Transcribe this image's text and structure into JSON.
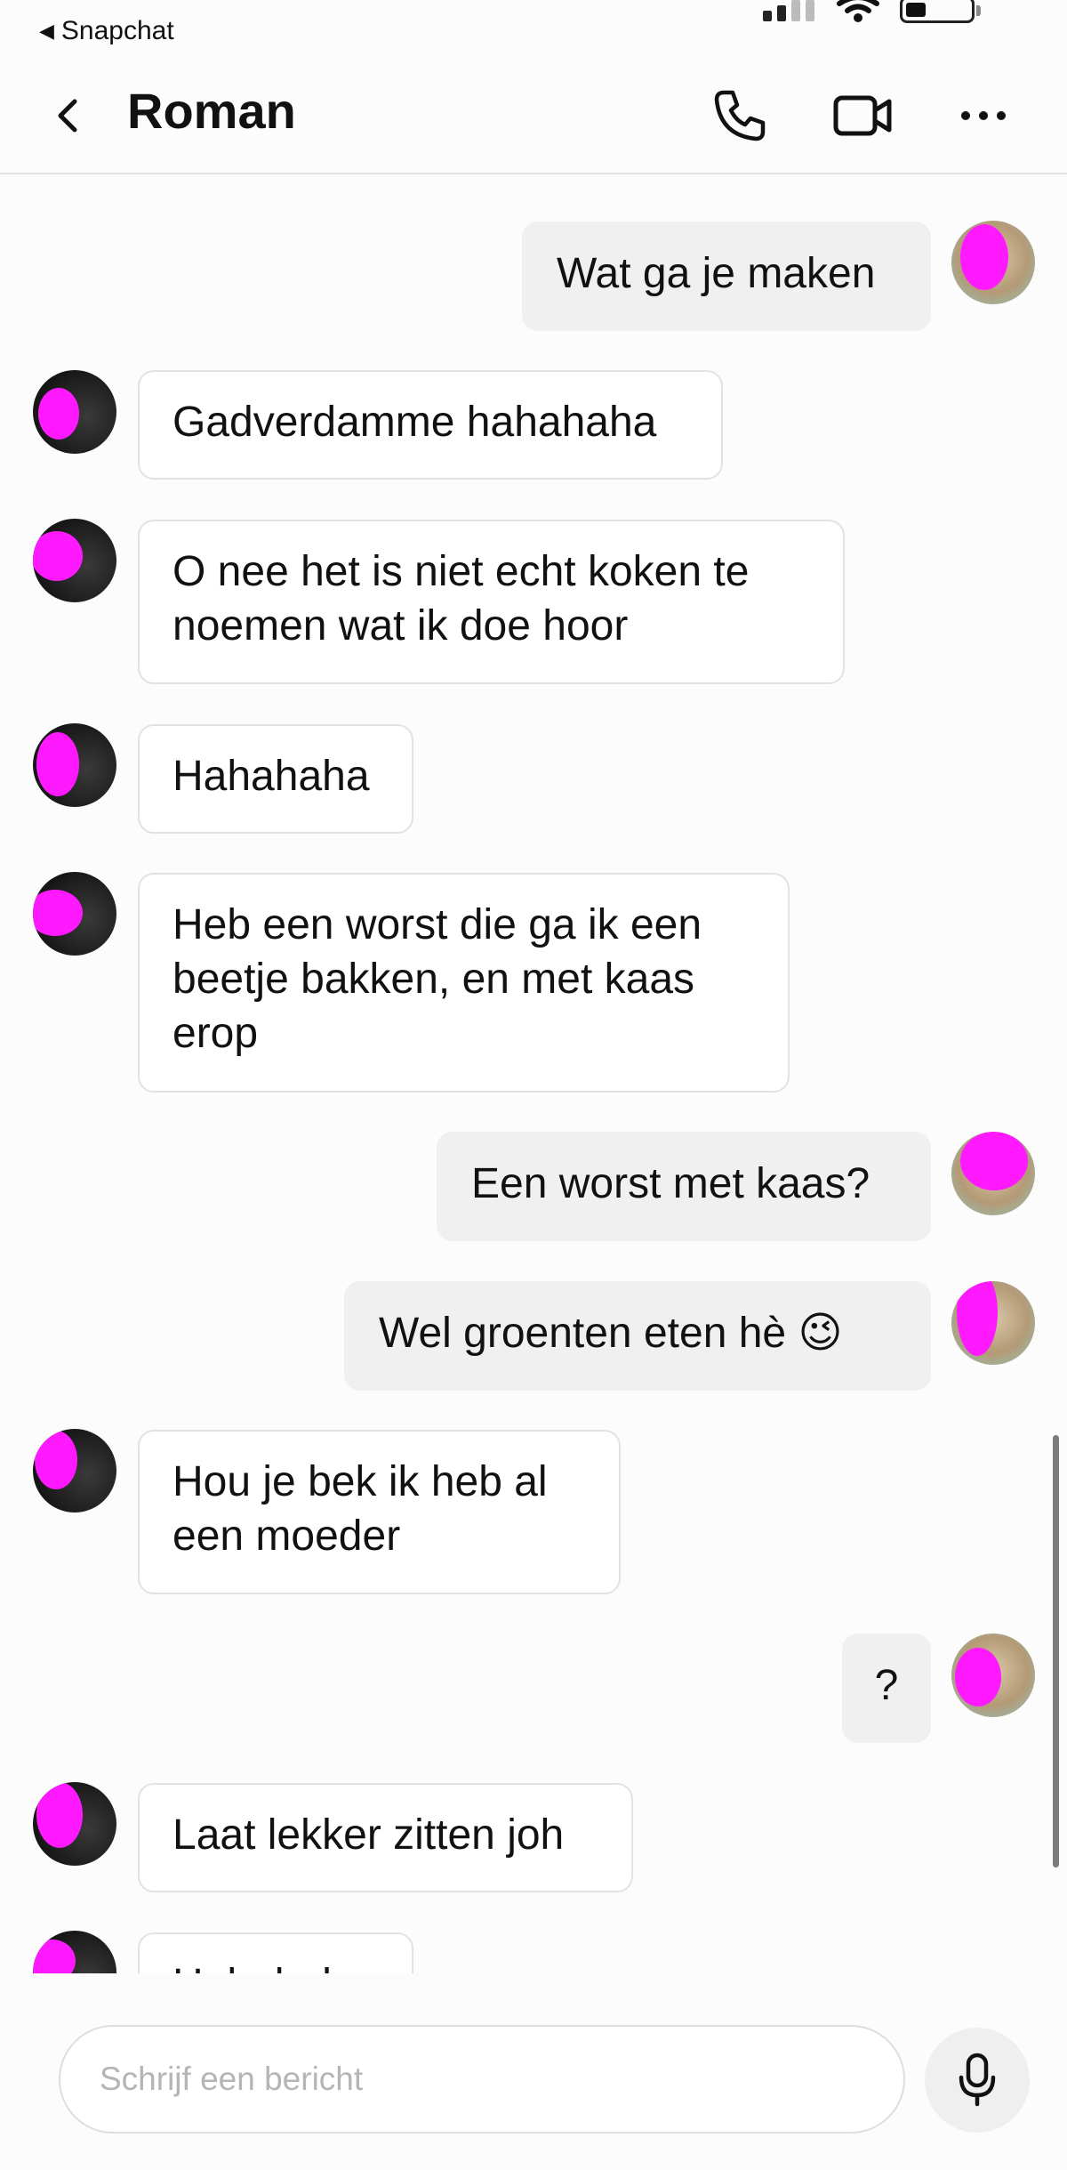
{
  "status_bar": {
    "back_app_label": "Snapchat"
  },
  "header": {
    "title": "Roman"
  },
  "messages": [
    {
      "sender": "me",
      "text": "Wat ga je maken"
    },
    {
      "sender": "them",
      "text": "Gadverdamme hahahaha"
    },
    {
      "sender": "them",
      "text": "O nee het is niet echt koken te\nnoemen wat ik doe hoor"
    },
    {
      "sender": "them",
      "text": "Hahahaha"
    },
    {
      "sender": "them",
      "text": "Heb een worst die ga ik een\nbeetje bakken, en met kaas\nerop"
    },
    {
      "sender": "me",
      "text": "Een worst met kaas?"
    },
    {
      "sender": "me",
      "text": "Wel groenten eten hè 😉"
    },
    {
      "sender": "them",
      "text": "Hou je bek ik heb al\neen moeder"
    },
    {
      "sender": "me",
      "text": "?"
    },
    {
      "sender": "them",
      "text": "Laat lekker zitten joh"
    },
    {
      "sender": "them",
      "text": "Hahahaha"
    }
  ],
  "composer": {
    "placeholder": "Schrijf een bericht"
  },
  "colors": {
    "incoming_bubble": "#ffffff",
    "outgoing_bubble": "#f0f0f0",
    "privacy_mask": "#ff19ff"
  }
}
